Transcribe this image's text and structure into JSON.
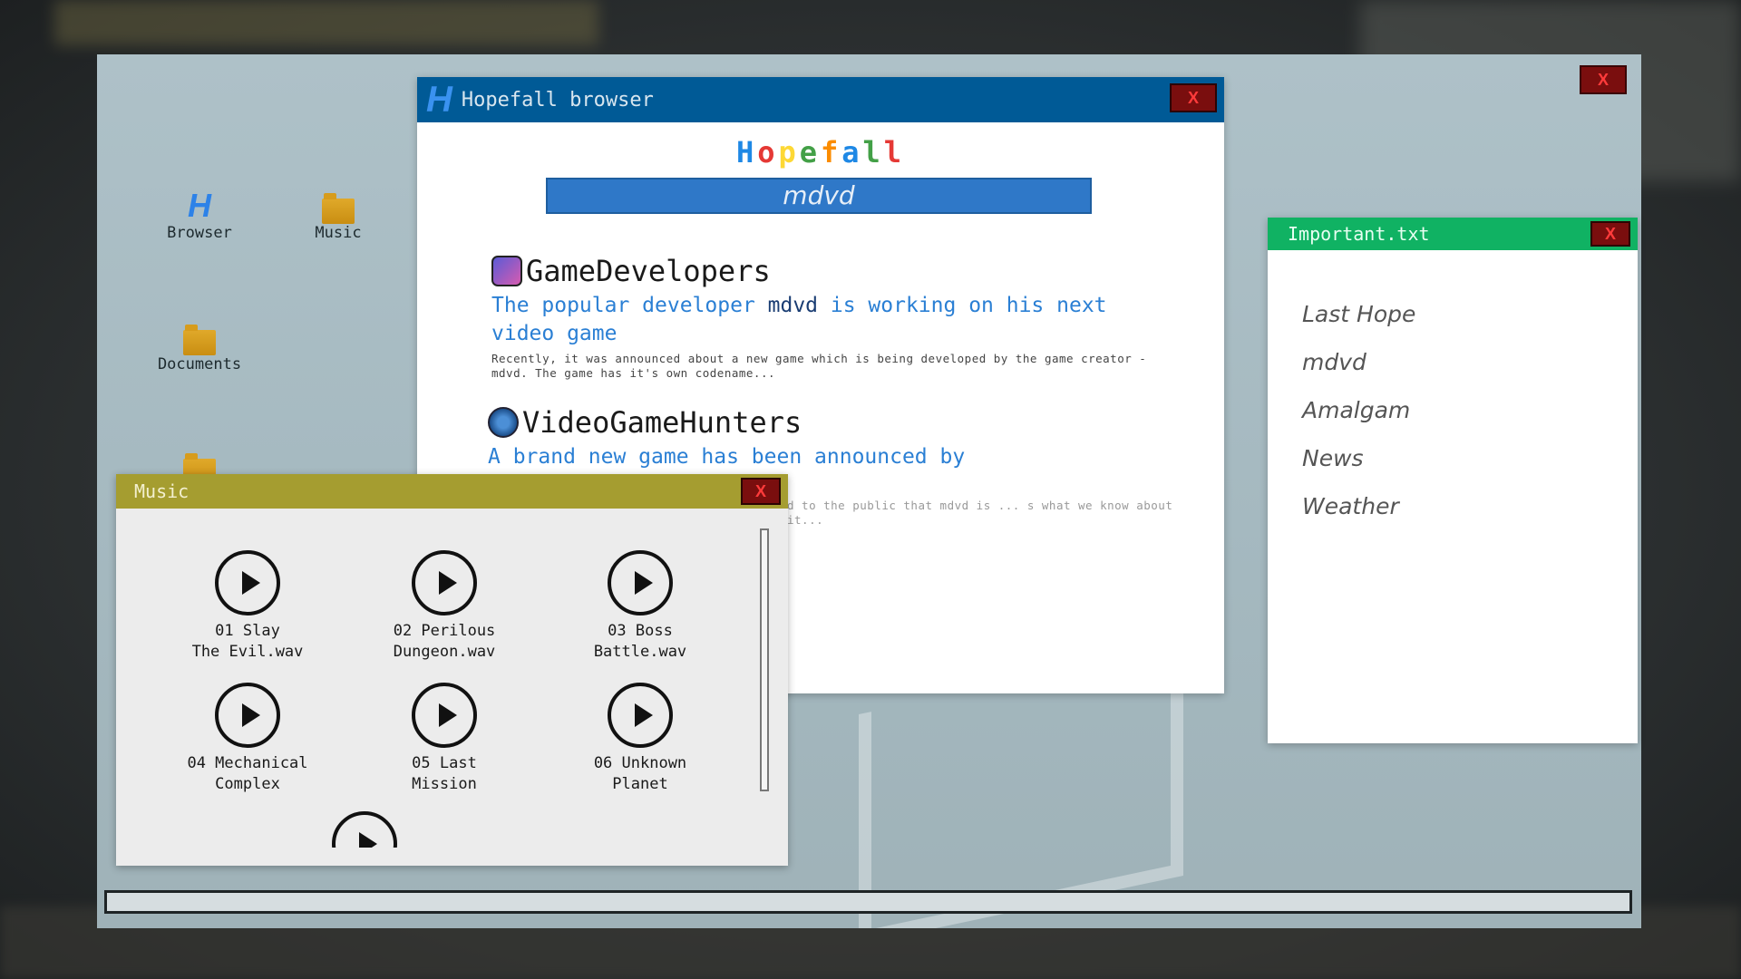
{
  "desktop": {
    "close_label": "X",
    "icons": [
      {
        "label": "Browser",
        "icon": "browser-h-icon"
      },
      {
        "label": "Music",
        "icon": "folder-icon"
      },
      {
        "label": "Documents",
        "icon": "folder-icon"
      },
      {
        "label": "",
        "icon": "folder-icon"
      }
    ]
  },
  "browser": {
    "title_logo": "H",
    "title": "Hopefall browser",
    "close_label": "X",
    "brand_letters": [
      "H",
      "o",
      "p",
      "e",
      "f",
      "a",
      "l",
      "l"
    ],
    "brand_colors": [
      "#1e88e5",
      "#e53935",
      "#fdd835",
      "#43a047",
      "#fb8c00",
      "#1e88e5",
      "#43a047",
      "#e53935"
    ],
    "search_value": "mdvd",
    "results": [
      {
        "site": "GameDevelopers",
        "headline_pre": "The popular developer ",
        "headline_hl": "mdvd",
        "headline_post": " is working on his next video game",
        "snippet": "Recently, it was announced about a new game which is being developed by the game creator - mdvd. The game has it's own codename..."
      },
      {
        "site": "VideoGameHunters",
        "headline": "A brand new game has been announced by",
        "snippet": "d to the public that mdvd is ... s what we know about it..."
      }
    ]
  },
  "music": {
    "title": "Music",
    "close_label": "X",
    "tracks": [
      {
        "line1": "01 Slay",
        "line2": "The Evil.wav"
      },
      {
        "line1": "02 Perilous",
        "line2": "Dungeon.wav"
      },
      {
        "line1": "03 Boss",
        "line2": "Battle.wav"
      },
      {
        "line1": "04 Mechanical",
        "line2": "Complex"
      },
      {
        "line1": "05 Last",
        "line2": "Mission"
      },
      {
        "line1": "06 Unknown",
        "line2": "Planet"
      }
    ]
  },
  "important": {
    "title": "Important.txt",
    "close_label": "X",
    "lines": [
      "Last Hope",
      "mdvd",
      "Amalgam",
      "News",
      "Weather"
    ]
  }
}
